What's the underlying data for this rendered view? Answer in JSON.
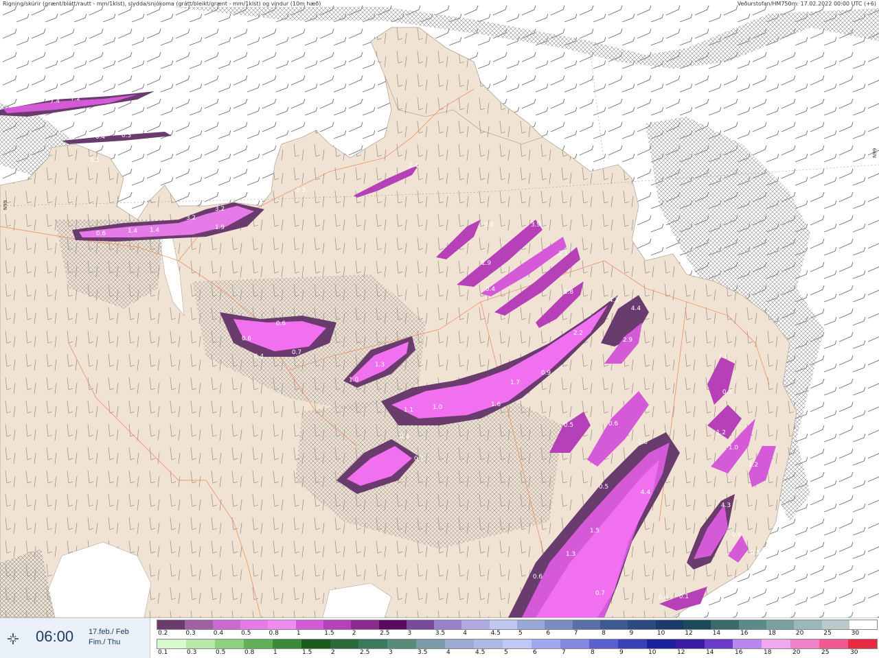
{
  "header": {
    "left_title": "Rigning/skúrir (grænt/blátt/rautt - mm/1klst), slydda/snjókoma (grátt/bleikt/grænt - mm/1klst) og vindur (10m hæð)",
    "right_title": "Veðurstofan/HM750m: 17.02.2022 00:00 UTC (+6)"
  },
  "map": {
    "coord_labels": [
      "N99",
      "N99"
    ],
    "colors": {
      "sea": "#ffffff",
      "land": "#f1e3d4",
      "roads": "#f08a5a",
      "precip_dark": "#6a3b6d",
      "precip_mid": "#b847c0",
      "precip_light": "#f070f0"
    },
    "value_labels": [
      "7.4",
      "7.2",
      "0.4",
      "0.3",
      "0.1",
      "0.5",
      "2.4",
      "0.3",
      "3.2",
      "3.2",
      "1.9",
      "0.6",
      "1.4",
      "1.4",
      "0.8",
      "3.9",
      "2.1",
      "1.9",
      "0.4",
      "1.8",
      "0.6",
      "0.6",
      "0.4",
      "0.7",
      "1.3",
      "1.0",
      "4.2",
      "4.4",
      "2.9",
      "2.2",
      "0.9",
      "1.7",
      "1.1",
      "1.0",
      "1.6",
      "0.4",
      "0.7",
      "0.5",
      "0.6",
      "1.0",
      "0.5",
      "4.4",
      "1.5",
      "1.3",
      "0.6",
      "0.7",
      "1.1",
      "0.3",
      "1.2",
      "1.0",
      "1.2",
      "4.3",
      "0.6",
      "0.5",
      "0.4",
      "0.1"
    ]
  },
  "time_panel": {
    "icon": "crosshair-icon",
    "time": "06:00",
    "date_line_1": "17.feb./ Feb",
    "date_line_2": "Fim./ Thu"
  },
  "legend": {
    "snow_scale": {
      "labels": [
        "0.2",
        "0.3",
        "0.4",
        "0.5",
        "0.8",
        "1",
        "1.5",
        "2",
        "2.5",
        "3",
        "3.5",
        "4",
        "4.5",
        "5",
        "6",
        "7",
        "8",
        "9",
        "10",
        "12",
        "14",
        "16",
        "18",
        "20",
        "25",
        "30"
      ],
      "colors": [
        "#6a3b6d",
        "#a060a4",
        "#c86ad0",
        "#e57ae8",
        "#f08cf0",
        "#d45ad8",
        "#b540b8",
        "#8a2a8e",
        "#5a0a5e",
        "#7a4a9a",
        "#9a80c8",
        "#b0a8e0",
        "#c0c8f0",
        "#9aa8d8",
        "#7a8cc0",
        "#5a70a8",
        "#3a5a90",
        "#2a4a80",
        "#1a3a6a",
        "#1a4a5a",
        "#3a6a6a",
        "#5a8a8a",
        "#7aa0a0",
        "#9ab8b8",
        "#bacaca",
        "#ffffff"
      ]
    },
    "rain_scale": {
      "labels": [
        "0.1",
        "0.3",
        "0.5",
        "0.8",
        "1",
        "1.5",
        "2",
        "2.5",
        "3",
        "3.5",
        "4",
        "4.5",
        "5",
        "6",
        "7",
        "8",
        "9",
        "10",
        "12",
        "14",
        "16",
        "18",
        "20",
        "25",
        "30"
      ],
      "colors": [
        "#d8f8d0",
        "#b8e8a8",
        "#8ed080",
        "#62b058",
        "#3a8a3a",
        "#1a5a1a",
        "#2a6a3a",
        "#3a7a5a",
        "#5a8a7a",
        "#7a9aa8",
        "#9aaad0",
        "#b0b8e8",
        "#c0c8f8",
        "#a0a8f0",
        "#8088e0",
        "#5a60d0",
        "#3a40b8",
        "#1a20a0",
        "#3a1aa0",
        "#6a3ac8",
        "#b888f0",
        "#f0a8f0",
        "#f080c8",
        "#f05a90",
        "#e82a40"
      ]
    }
  }
}
